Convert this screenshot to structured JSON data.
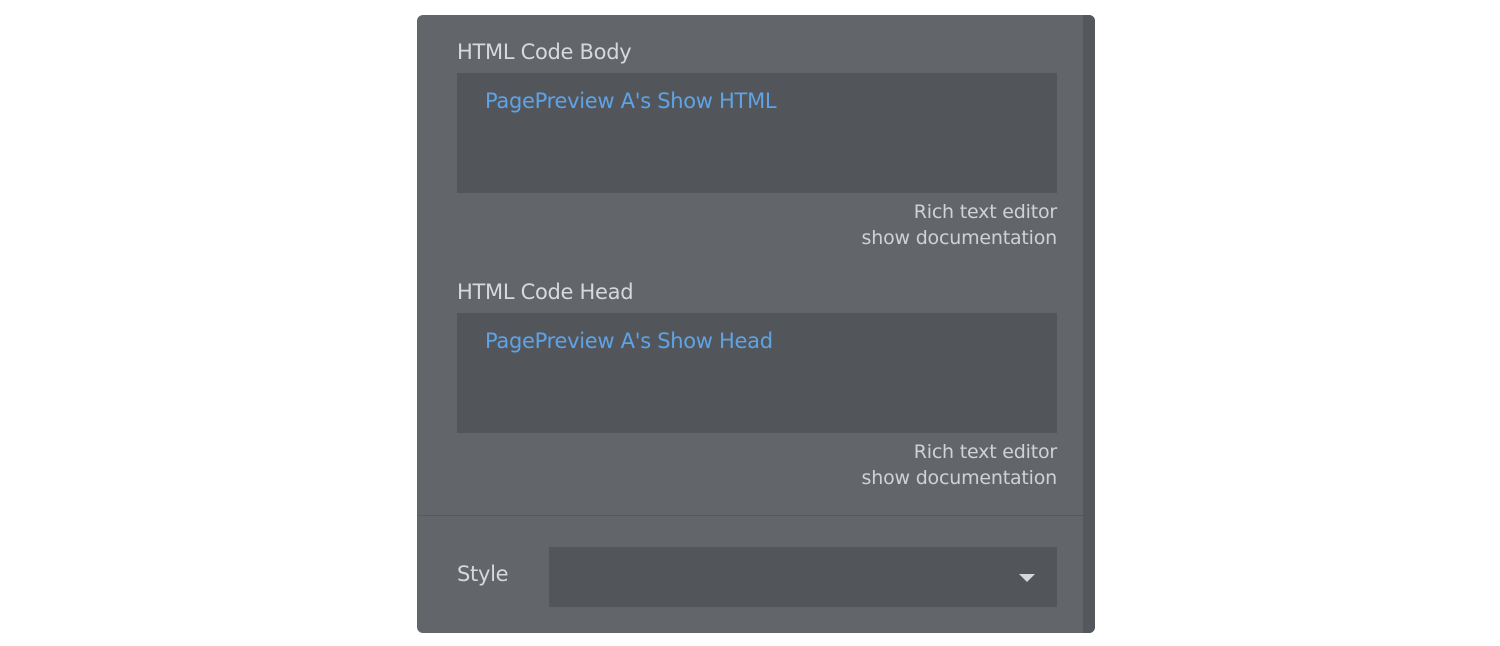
{
  "html_body": {
    "label": "HTML Code Body",
    "value": "PagePreview A's Show HTML",
    "rich_text_link": "Rich text editor",
    "docs_link": "show documentation"
  },
  "html_head": {
    "label": "HTML Code Head",
    "value": "PagePreview A's Show Head",
    "rich_text_link": "Rich text editor",
    "docs_link": "show documentation"
  },
  "style": {
    "label": "Style",
    "selected": "",
    "icon": "chevron-down-icon"
  },
  "colors": {
    "panel_bg": "#62666a",
    "input_bg": "#52565a",
    "dynamic_text": "#5fa3e6",
    "label_text": "#d6d8da"
  }
}
